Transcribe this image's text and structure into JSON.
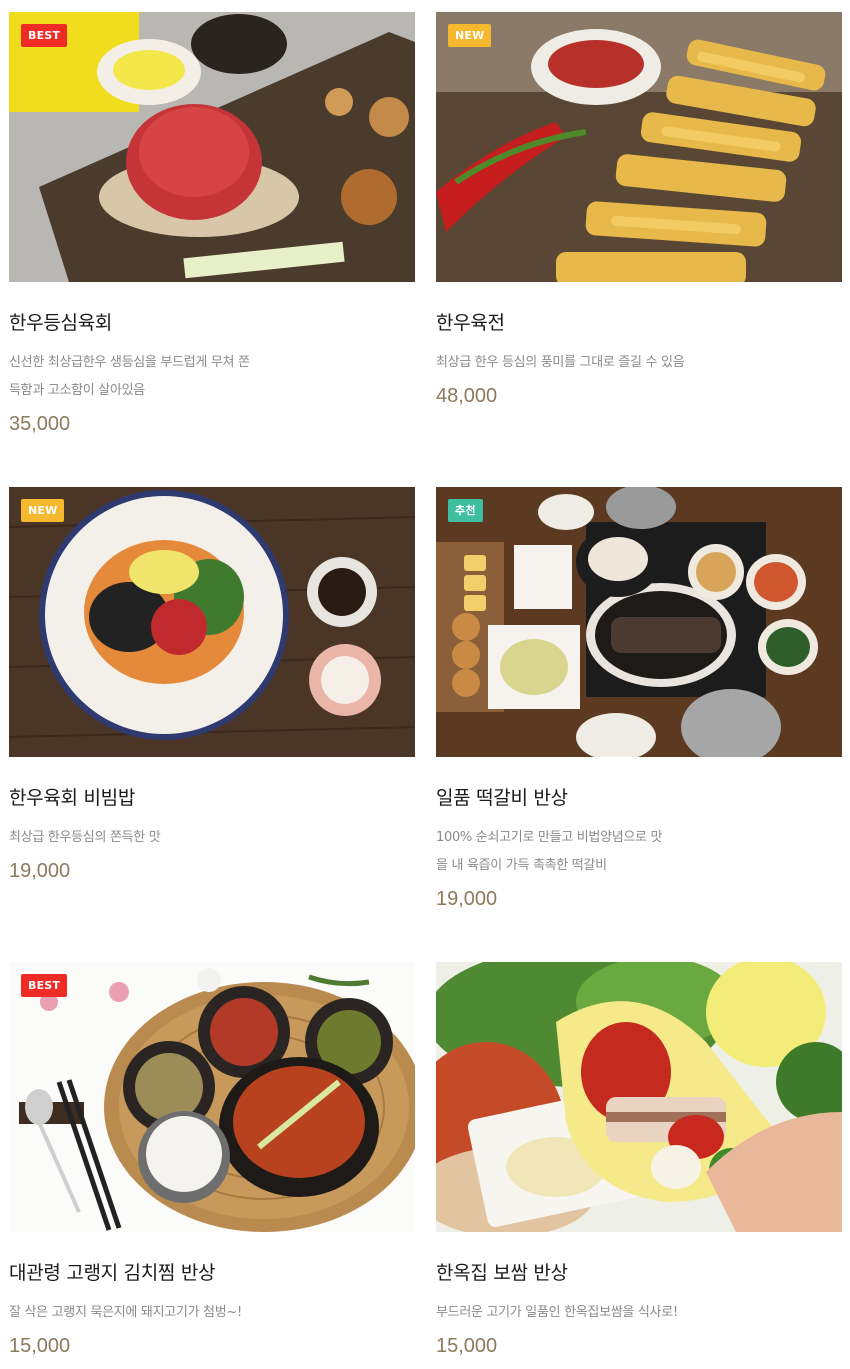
{
  "colors": {
    "best": "#ee2b24",
    "new": "#f5b82e",
    "recommend": "#3fbf9f",
    "price": "#8c7a5a"
  },
  "menu": [
    {
      "badge": "BEST",
      "badge_type": "best",
      "name": "한우등심육회",
      "desc_lines": [
        "신선한 최상급한우 생등심을 부드럽게 무쳐 쫀",
        "득함과 고소함이 살아있음"
      ],
      "price": "35,000"
    },
    {
      "badge": "NEW",
      "badge_type": "new",
      "name": "한우육전",
      "desc_lines": [
        "최상급 한우 등심의 풍미를 그대로 즐길 수 있음"
      ],
      "price": "48,000"
    },
    {
      "badge": "NEW",
      "badge_type": "new",
      "name": "한우육회 비빔밥",
      "desc_lines": [
        "최상급 한우등심의 쫀득한 맛"
      ],
      "price": "19,000"
    },
    {
      "badge": "추천",
      "badge_type": "recommend",
      "name": "일품 떡갈비 반상",
      "desc_lines": [
        "100% 순쇠고기로 만들고 비법양념으로 맛",
        "을 내 육즙이 가득 촉촉한 떡갈비"
      ],
      "price": "19,000"
    },
    {
      "badge": "BEST",
      "badge_type": "best",
      "name": "대관령 고랭지 김치찜 반상",
      "desc_lines": [
        "잘 삭은 고랭지 묵은지에 돼지고기가 첨벙~!"
      ],
      "price": "15,000"
    },
    {
      "badge": "",
      "badge_type": "none",
      "name": "한옥집 보쌈 반상",
      "desc_lines": [
        "부드러운 고기가 일품인 한옥집보쌈을 식사로!"
      ],
      "price": "15,000"
    }
  ]
}
